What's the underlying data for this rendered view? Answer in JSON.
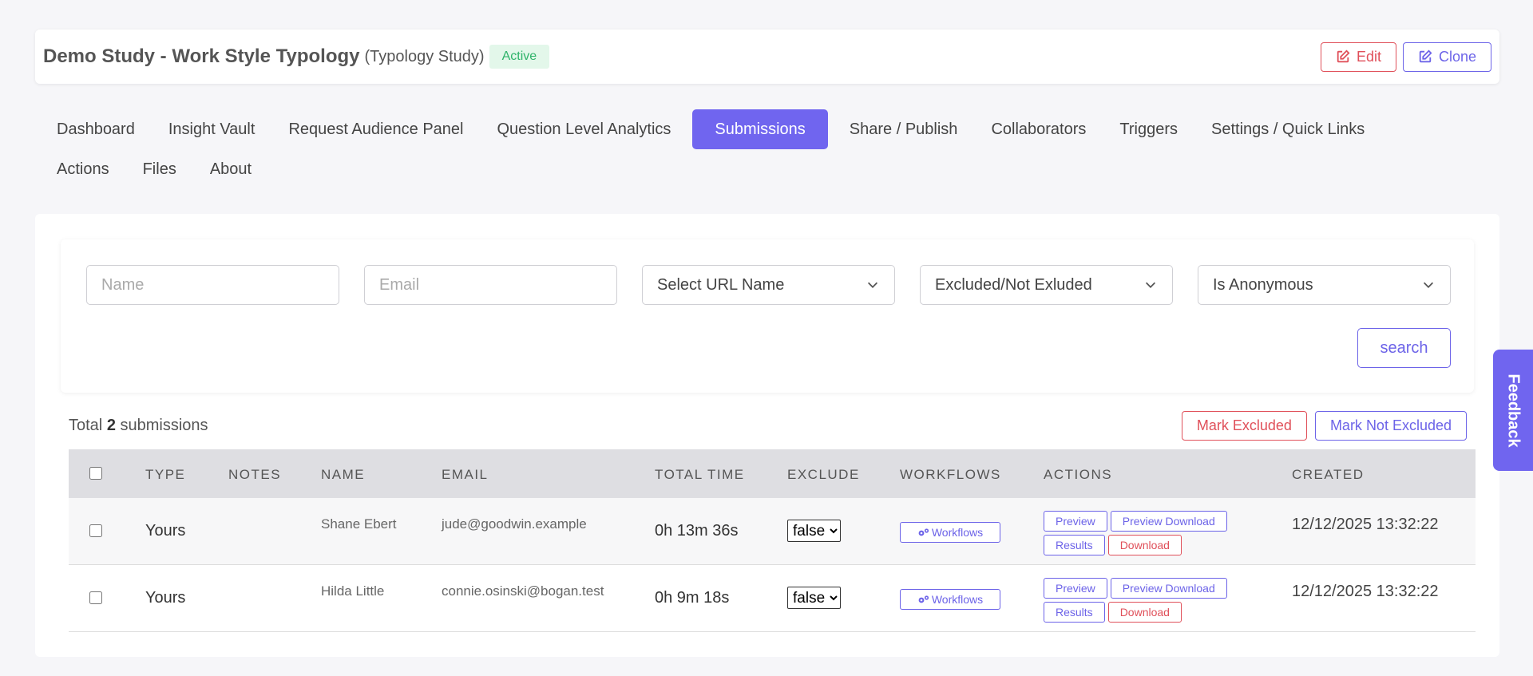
{
  "header": {
    "title": "Demo Study - Work Style Typology",
    "type_label": "(Typology Study)",
    "status": "Active",
    "edit_label": "Edit",
    "clone_label": "Clone"
  },
  "tabs": {
    "row1": [
      {
        "label": "Dashboard"
      },
      {
        "label": "Insight Vault"
      },
      {
        "label": "Request Audience Panel"
      },
      {
        "label": "Question Level Analytics"
      },
      {
        "label": "Submissions",
        "active": true
      },
      {
        "label": "Share / Publish"
      },
      {
        "label": "Collaborators"
      },
      {
        "label": "Triggers"
      },
      {
        "label": "Settings / Quick Links"
      }
    ],
    "row2": [
      {
        "label": "Actions"
      },
      {
        "label": "Files"
      },
      {
        "label": "About"
      }
    ]
  },
  "filters": {
    "name_placeholder": "Name",
    "email_placeholder": "Email",
    "url_select": "Select URL Name",
    "excluded_select": "Excluded/Not Exluded",
    "anonymous_select": "Is Anonymous",
    "search_label": "search"
  },
  "summary": {
    "prefix": "Total",
    "count": "2",
    "suffix": "submissions",
    "mark_excluded": "Mark Excluded",
    "mark_not_excluded": "Mark Not Excluded"
  },
  "table": {
    "headers": {
      "type": "TYPE",
      "notes": "NOTES",
      "name": "NAME",
      "email": "EMAIL",
      "total_time": "TOTAL TIME",
      "exclude": "EXCLUDE",
      "workflows": "WORKFLOWS",
      "actions": "ACTIONS",
      "created": "CREATED"
    },
    "rows": [
      {
        "type": "Yours",
        "notes": "",
        "name": "Shane Ebert",
        "email": "jude@goodwin.example",
        "total_time": "0h 13m 36s",
        "exclude": "false",
        "workflows_label": "Workflows",
        "created": "12/12/2025 13:32:22"
      },
      {
        "type": "Yours",
        "notes": "",
        "name": "Hilda Little",
        "email": "connie.osinski@bogan.test",
        "total_time": "0h 9m 18s",
        "exclude": "false",
        "workflows_label": "Workflows",
        "created": "12/12/2025 13:32:22"
      }
    ],
    "row_actions": {
      "preview": "Preview",
      "preview_download": "Preview Download",
      "results": "Results",
      "download": "Download"
    }
  },
  "feedback_label": "Feedback",
  "colors": {
    "accent": "#7065ef",
    "danger": "#e0505a",
    "success": "#2fb36a"
  }
}
